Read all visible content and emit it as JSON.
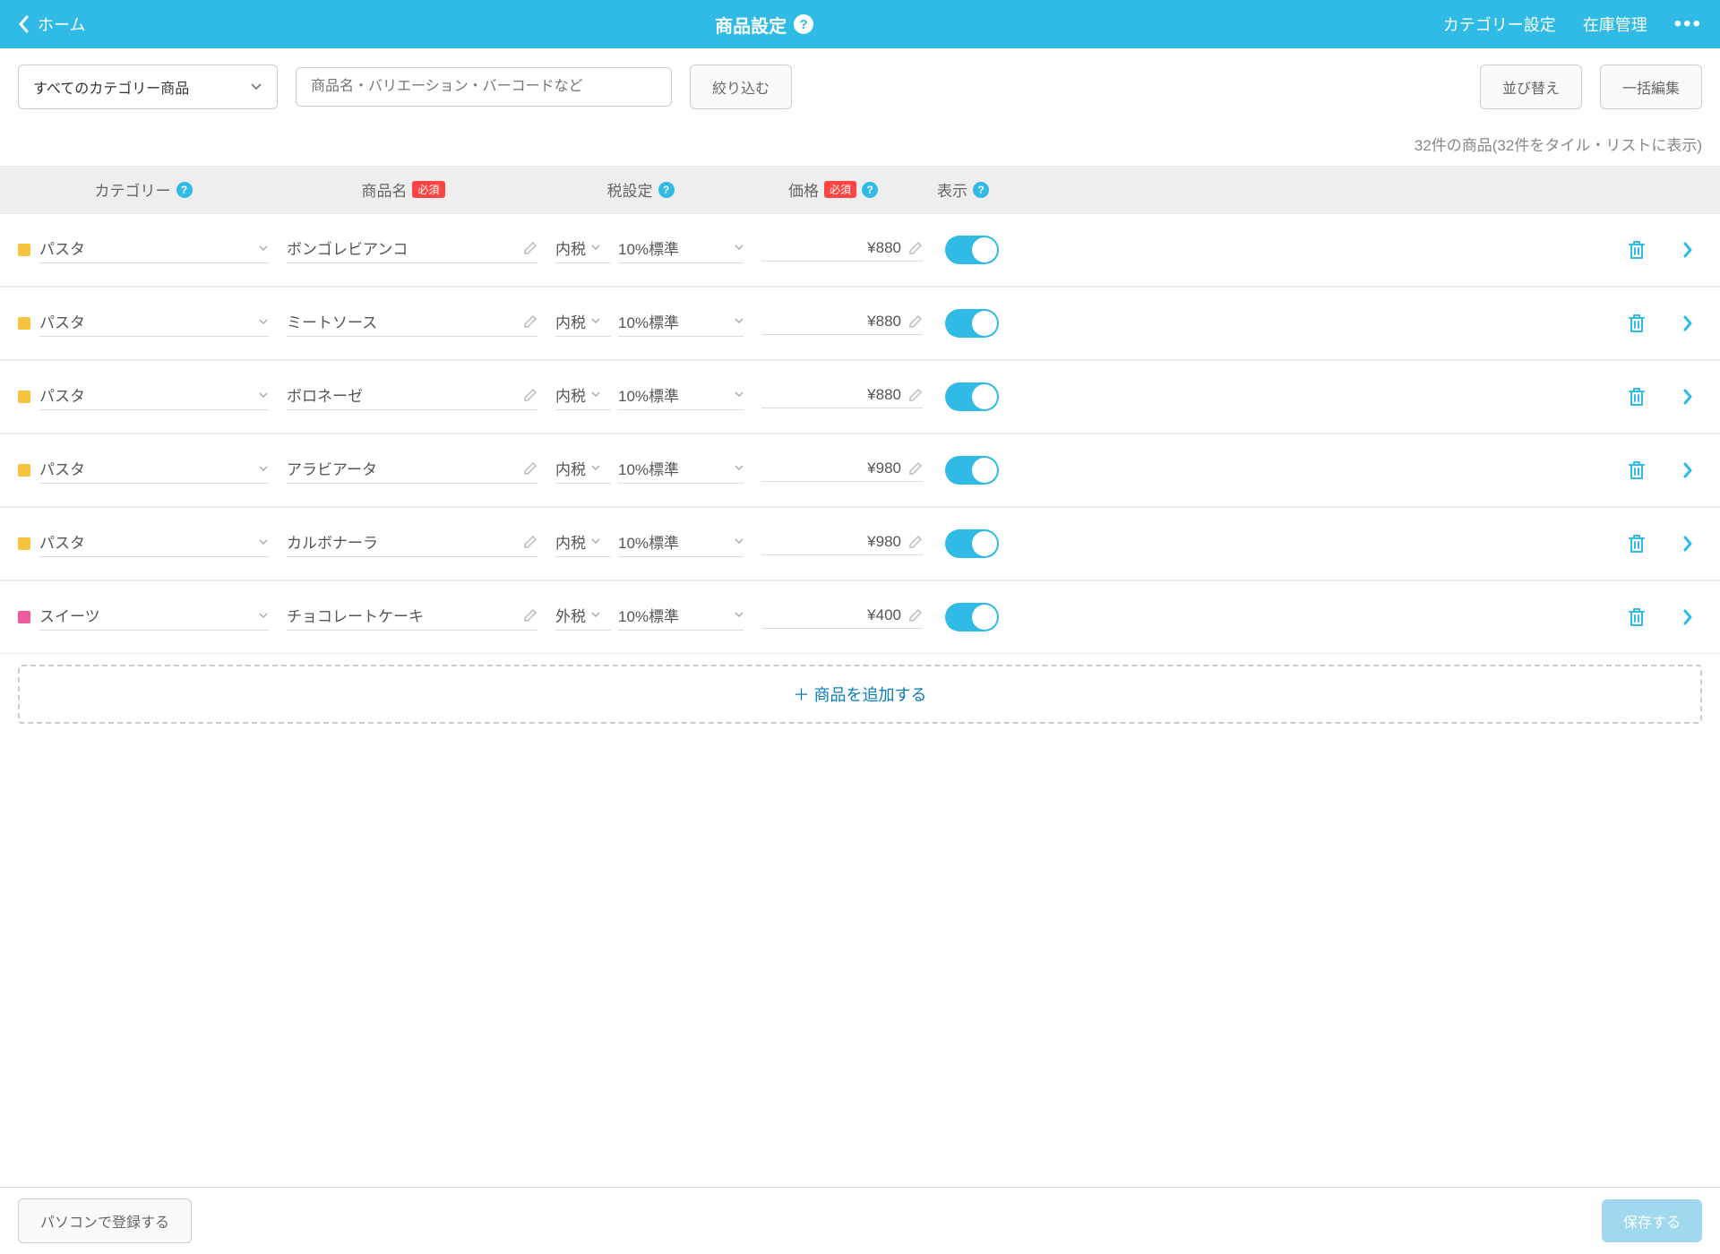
{
  "header": {
    "back_label": "ホーム",
    "title": "商品設定",
    "nav_category": "カテゴリー設定",
    "nav_stock": "在庫管理"
  },
  "filter": {
    "category_select": "すべてのカテゴリー商品",
    "search_placeholder": "商品名・バリエーション・バーコードなど",
    "filter_btn": "絞り込む",
    "sort_btn": "並び替え",
    "bulk_btn": "一括編集"
  },
  "count_text": "32件の商品(32件をタイル・リストに表示)",
  "columns": {
    "category": "カテゴリー",
    "name": "商品名",
    "tax": "税設定",
    "price": "価格",
    "show": "表示",
    "required": "必須"
  },
  "colors": {
    "yellow": "#f5c542",
    "pink": "#f05a9e"
  },
  "rows": [
    {
      "cat": "パスタ",
      "color": "yellow",
      "name": "ボンゴレビアンコ",
      "tax1": "内税",
      "tax2": "10%標準",
      "price": "¥880"
    },
    {
      "cat": "パスタ",
      "color": "yellow",
      "name": "ミートソース",
      "tax1": "内税",
      "tax2": "10%標準",
      "price": "¥880"
    },
    {
      "cat": "パスタ",
      "color": "yellow",
      "name": "ボロネーゼ",
      "tax1": "内税",
      "tax2": "10%標準",
      "price": "¥880"
    },
    {
      "cat": "パスタ",
      "color": "yellow",
      "name": "アラビアータ",
      "tax1": "内税",
      "tax2": "10%標準",
      "price": "¥980"
    },
    {
      "cat": "パスタ",
      "color": "yellow",
      "name": "カルボナーラ",
      "tax1": "内税",
      "tax2": "10%標準",
      "price": "¥980"
    },
    {
      "cat": "スイーツ",
      "color": "pink",
      "name": "チョコレートケーキ",
      "tax1": "外税",
      "tax2": "10%標準",
      "price": "¥400"
    }
  ],
  "add_label": "＋ 商品を追加する",
  "footer": {
    "pc_btn": "パソコンで登録する",
    "save_btn": "保存する"
  }
}
